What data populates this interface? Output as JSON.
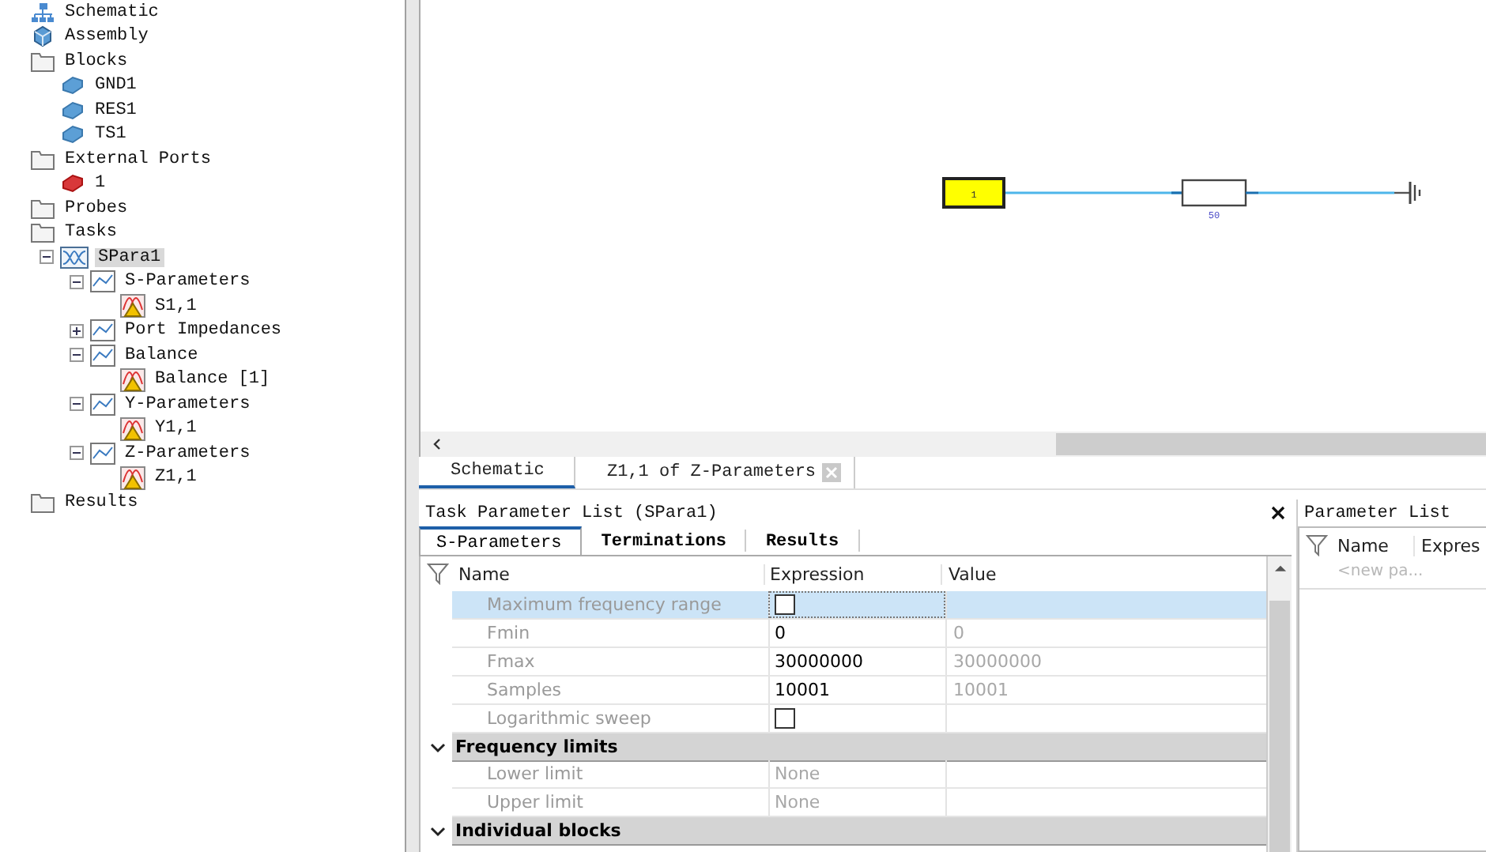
{
  "tree": [
    {
      "label": "Schematic",
      "kind": "schematic",
      "selected": false
    },
    {
      "label": "Assembly",
      "kind": "assembly",
      "selected": false
    },
    {
      "label": "Blocks",
      "kind": "folder",
      "selected": false,
      "children": [
        {
          "label": "GND1",
          "kind": "block",
          "selected": false
        },
        {
          "label": "RES1",
          "kind": "block",
          "selected": false
        },
        {
          "label": "TS1",
          "kind": "block",
          "selected": false
        }
      ]
    },
    {
      "label": "External Ports",
      "kind": "folder",
      "selected": false,
      "children": [
        {
          "label": "1",
          "kind": "port",
          "selected": false
        }
      ]
    },
    {
      "label": "Probes",
      "kind": "folder",
      "selected": false
    },
    {
      "label": "Tasks",
      "kind": "folder",
      "selected": false,
      "children": [
        {
          "label": "SPara1",
          "kind": "task",
          "selected": true,
          "expanded": true,
          "children": [
            {
              "label": "S-Parameters",
              "kind": "chart",
              "selected": false,
              "expanded": true,
              "children": [
                {
                  "label": "S1,1",
                  "kind": "result",
                  "selected": false
                }
              ]
            },
            {
              "label": "Port Impedances",
              "kind": "chart",
              "selected": false,
              "expanded": false
            },
            {
              "label": "Balance",
              "kind": "chart",
              "selected": false,
              "expanded": true,
              "children": [
                {
                  "label": "Balance [1]",
                  "kind": "result",
                  "selected": false
                }
              ]
            },
            {
              "label": "Y-Parameters",
              "kind": "chart",
              "selected": false,
              "expanded": true,
              "children": [
                {
                  "label": "Y1,1",
                  "kind": "result",
                  "selected": false
                }
              ]
            },
            {
              "label": "Z-Parameters",
              "kind": "chart",
              "selected": false,
              "expanded": true,
              "children": [
                {
                  "label": "Z1,1",
                  "kind": "result",
                  "selected": false
                }
              ]
            }
          ]
        }
      ]
    },
    {
      "label": "Results",
      "kind": "folder",
      "selected": false
    }
  ],
  "schematic": {
    "port_label": "1",
    "resistor_label": "50"
  },
  "doc_tabs": [
    {
      "label": "Schematic",
      "selected": true,
      "closable": false
    },
    {
      "label": "Z1,1 of Z-Parameters",
      "selected": false,
      "closable": true
    }
  ],
  "task_panel": {
    "title": "Task Parameter List (SPara1)",
    "tabs": [
      {
        "label": "S-Parameters",
        "selected": true
      },
      {
        "label": "Terminations",
        "selected": false
      },
      {
        "label": "Results",
        "selected": false
      }
    ],
    "columns": [
      "Name",
      "Expression",
      "Value"
    ],
    "rows": [
      {
        "kind": "check",
        "name": "Maximum frequency range",
        "checked": false,
        "selected": true
      },
      {
        "kind": "value",
        "name": "Fmin",
        "expression": "0",
        "value": "0",
        "readonly": false,
        "selected": false
      },
      {
        "kind": "value",
        "name": "Fmax",
        "expression": "30000000",
        "value": "30000000",
        "readonly": false,
        "selected": false
      },
      {
        "kind": "value",
        "name": "Samples",
        "expression": "10001",
        "value": "10001",
        "readonly": false,
        "selected": false
      },
      {
        "kind": "check",
        "name": "Logarithmic sweep",
        "checked": false,
        "selected": false
      },
      {
        "kind": "group",
        "name": "Frequency limits",
        "expanded": true
      },
      {
        "kind": "value",
        "name": "Lower limit",
        "expression": "None",
        "readonly": true,
        "selected": false
      },
      {
        "kind": "value",
        "name": "Upper limit",
        "expression": "None",
        "readonly": true,
        "selected": false
      },
      {
        "kind": "group",
        "name": "Individual blocks",
        "expanded": true
      }
    ]
  },
  "param_panel": {
    "title": "Parameter List",
    "columns": [
      "Name",
      "Expres"
    ],
    "placeholder": "<new pa..."
  }
}
